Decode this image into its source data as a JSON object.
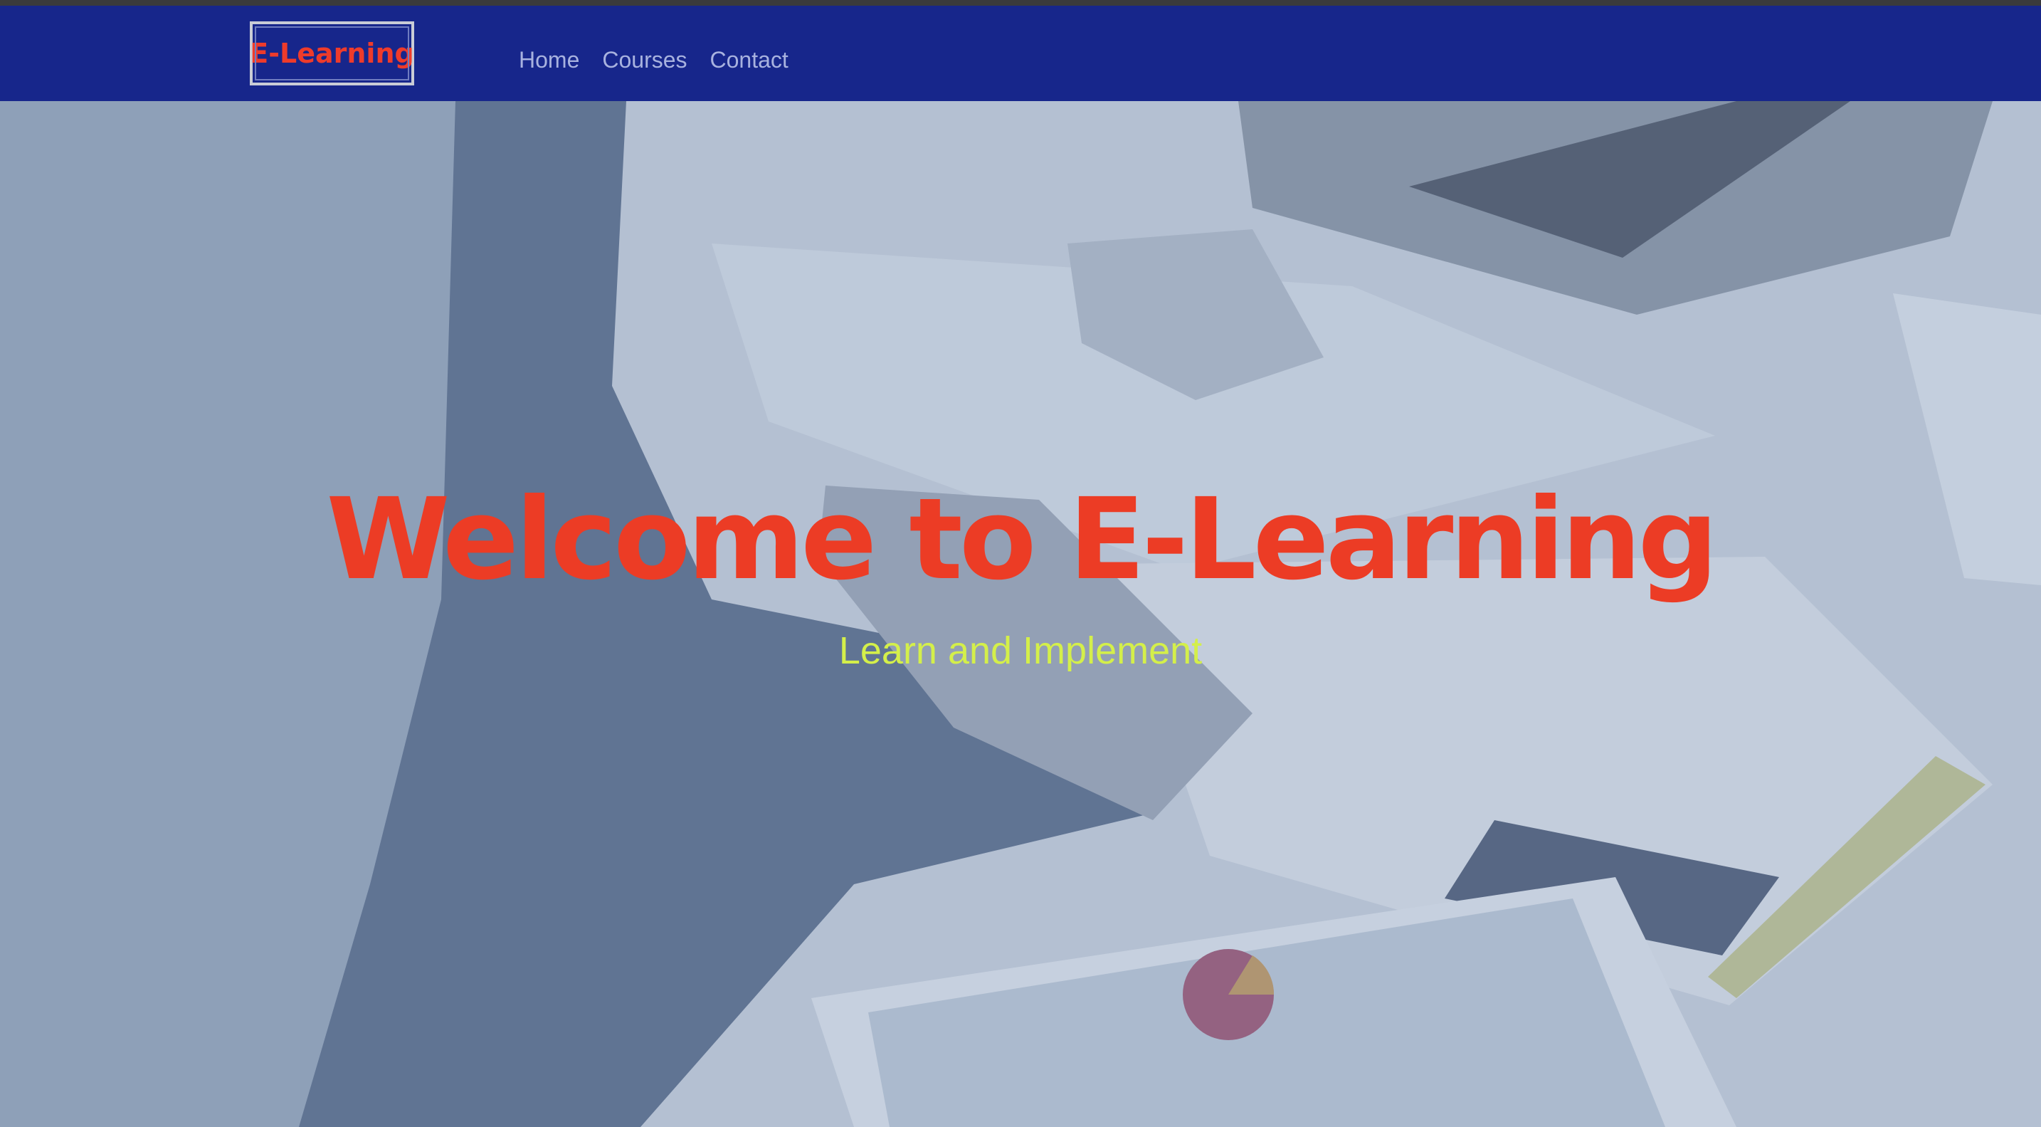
{
  "brand": {
    "name": "E-Learning"
  },
  "nav": {
    "items": [
      {
        "label": "Home"
      },
      {
        "label": "Courses"
      },
      {
        "label": "Contact"
      }
    ]
  },
  "hero": {
    "title": "Welcome to E-Learning",
    "subtitle": "Learn and Implement",
    "background_image": "business-meeting-desk-photo"
  },
  "colors": {
    "navbar": "#17268b",
    "brand_text": "#ee3b2b",
    "nav_link": "#a8b2df",
    "hero_title": "#ec3c25",
    "hero_subtitle": "#d4ef4a"
  }
}
